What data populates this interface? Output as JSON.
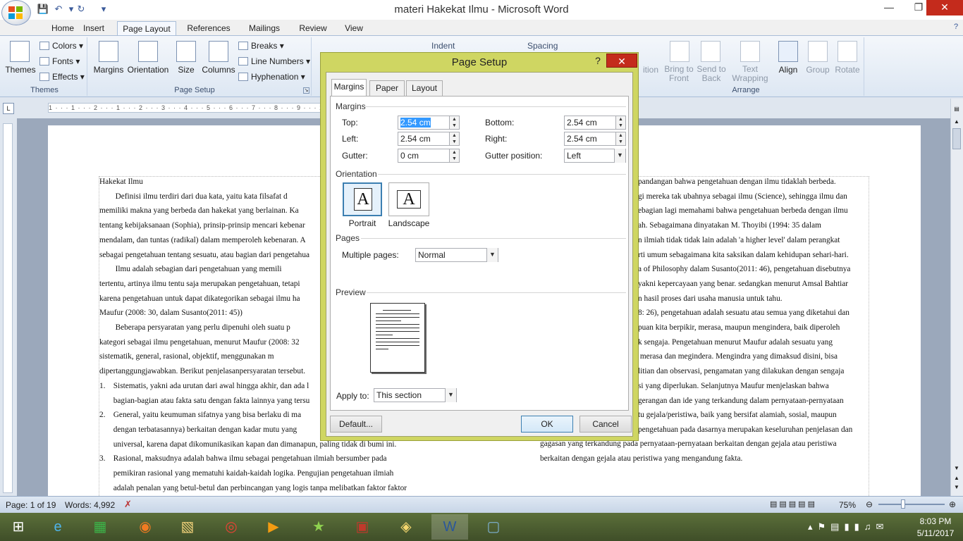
{
  "window": {
    "title": "materi Hakekat Ilmu - Microsoft Word",
    "minimize": "—",
    "restore": "❐",
    "close": "✕"
  },
  "ribbon": {
    "tabs": [
      "Home",
      "Insert",
      "Page Layout",
      "References",
      "Mailings",
      "Review",
      "View"
    ],
    "active_tab": "Page Layout",
    "themes_group": {
      "label": "Themes",
      "themes": "Themes",
      "colors": "Colors",
      "fonts": "Fonts",
      "effects": "Effects"
    },
    "page_setup_group": {
      "label": "Page Setup",
      "margins": "Margins",
      "orientation": "Orientation",
      "size": "Size",
      "columns": "Columns",
      "breaks": "Breaks",
      "line_numbers": "Line Numbers",
      "hyphenation": "Hyphenation"
    },
    "paragraph_group": {
      "indent": "Indent",
      "spacing": "Spacing"
    },
    "arrange_group": {
      "label": "Arrange",
      "position": "ition",
      "bring_front_1": "Bring to",
      "bring_front_2": "Front",
      "send_back_1": "Send to",
      "send_back_2": "Back",
      "wrap_1": "Text",
      "wrap_2": "Wrapping",
      "align": "Align",
      "group": "Group",
      "rotate": "Rotate"
    }
  },
  "ruler": {
    "text": "1 · · · 1 · · · 2 · · · 1 · · · 2 · · · 3 · · · 4 · · · 5 · · · 6 · · · 7 · · · 8 · · · 9 · · · 10"
  },
  "document": {
    "left_lines": [
      "Hakekat Ilmu",
      "        Definisi ilmu terdiri dari dua kata, yaitu kata filsafat d",
      "memiliki makna yang berbeda dan hakekat yang berlainan. Ka",
      "tentang kebijaksanaan (Sophia), prinsip-prinsip mencari kebenar",
      "mendalam, dan tuntas (radikal) dalam memperoleh kebenaran. A",
      "sebagai pengetahuan tentang sesuatu, atau bagian dari pengetahua",
      "        Ilmu adalah sebagian dari pengetahuan yang memili",
      "tertentu, artinya ilmu tentu saja merupakan pengetahuan, tetapi",
      "karena pengetahuan untuk dapat dikategorikan sebagai ilmu ha",
      "Maufur (2008: 30, dalam Susanto(2011: 45))",
      "        Beberapa persyaratan yang perlu dipenuhi oleh suatu p",
      "kategori sebagai ilmu pengetahuan, menurut Maufur (2008: 32",
      "sistematik, general, rasional, objektif, menggunakan m",
      "dipertanggungjawabkan. Berikut penjelasanpersyaratan tersebut.",
      "1.    Sistematis, yakni ada urutan dari awal hingga akhir, dan ada l",
      "       bagian-bagian atau fakta satu dengan fakta lainnya yang tersu",
      "2.    General, yaitu keumuman sifatnya yang bisa berlaku di ma",
      "       dengan terbatasannya) berkaitan dengan kadar mutu yang",
      "       universal, karena dapat dikomunikasikan kapan dan dimanapun, paling tidak di bumi ini.",
      "3.    Rasional, maksudnya adalah bahwa ilmu sebagai pengetahuan ilmiah bersumber pada",
      "       pemikiran rasional yang mematuhi kaidah-kaidah logika. Pengujian pengetahuan ilmiah",
      "       adalah penalan yang betul-betul dan perbincangan yang logis tanpa melibatkan faktor faktor"
    ],
    "right_lines": [
      "pandangan bahwa pengetahuan dengan ilmu tidaklah berbeda.",
      "gi mereka tak ubahnya sebagai ilmu (Science), sehingga ilmu dan",
      "ebagian lagi memahami bahwa pengetahuan berbeda dengan ilmu",
      "ah. Sebagaimana dinyatakan M. Thoyibi (1994: 35 dalam",
      "n ilmiah tidak tidak lain adalah 'a higher level' dalam perangkat",
      "rti umum sebagaimana kita saksikan dalam kehidupan sehari-hari.",
      "a of Philosophy dalam Susanto(2011: 46), pengetahuan disebutnya",
      "yakni kepercayaan yang benar. sedangkan menurut Amsal Bahtiar",
      "n hasil proses dari usaha manusia untuk tahu.",
      "8: 26), pengetahuan adalah sesuatu atau semua yang diketahui dan",
      "puan kita berpikir, merasa, maupun mengindera, baik diperoleh",
      "k sengaja. Pengetahuan menurut Maufur adalah sesuatu yang",
      " merasa dan megindera. Mengindra yang dimaksud disini, bisa",
      "litian dan observasi, pengamatan yang dilakukan dengan sengaja",
      "si yang diperlukan. Selanjutnya Maufur menjelaskan bahwa",
      "gerangan dan ide yang terkandung dalam pernyataan-pernyataan",
      "tu gejala/peristiwa, baik yang bersifat alamiah, sosial, maupun",
      "pengetahuan pada dasarnya merupakan keseluruhan penjelasan dan",
      "gagasan yang terkandung pada pernyataan-pernyataan berkaitan dengan gejala atau peristiwa",
      "berkaitan dengan gejala atau peristiwa yang mengandung fakta."
    ]
  },
  "dialog": {
    "title": "Page Setup",
    "help": "?",
    "close": "✕",
    "tabs": [
      "Margins",
      "Paper",
      "Layout"
    ],
    "margins_section": "Margins",
    "top_label": "Top:",
    "top_value": "2.54 cm",
    "bottom_label": "Bottom:",
    "bottom_value": "2.54 cm",
    "left_label": "Left:",
    "left_value": "2.54 cm",
    "right_label": "Right:",
    "right_value": "2.54 cm",
    "gutter_label": "Gutter:",
    "gutter_value": "0 cm",
    "gutter_pos_label": "Gutter position:",
    "gutter_pos_value": "Left",
    "orientation_section": "Orientation",
    "portrait": "Portrait",
    "landscape": "Landscape",
    "page_glyph": "A",
    "pages_section": "Pages",
    "multiple_pages_label": "Multiple pages:",
    "multiple_pages_value": "Normal",
    "preview_section": "Preview",
    "apply_to_label": "Apply to:",
    "apply_to_value": "This section",
    "default_btn": "Default...",
    "ok_btn": "OK",
    "cancel_btn": "Cancel"
  },
  "status": {
    "page": "Page: 1 of 19",
    "words": "Words: 4,992",
    "zoom": "75%"
  },
  "clock": {
    "time": "8:03 PM",
    "date": "5/11/2017"
  }
}
